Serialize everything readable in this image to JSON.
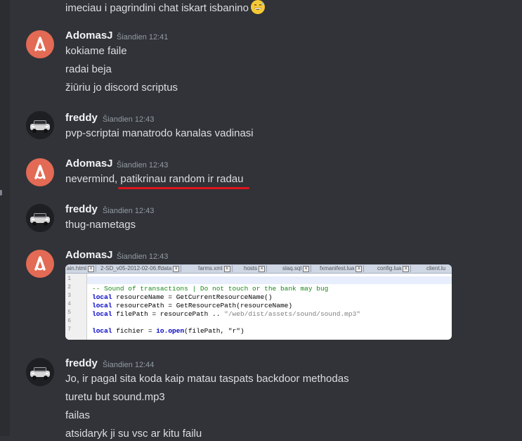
{
  "messages": [
    {
      "lines": [
        "imeciau i pagrindini chat iskart isbanino"
      ],
      "emoji": "grinning-sweat-face"
    },
    {
      "author": "AdomasJ",
      "time": "Šiandien 12:41",
      "avatar": "A",
      "lines": [
        "kokiame faile",
        "radai beja",
        "žiūriu jo discord scriptus"
      ]
    },
    {
      "author": "freddy",
      "time": "Šiandien 12:43",
      "lines": [
        "pvp-scriptai manatrodo kanalas vadinasi"
      ]
    },
    {
      "author": "AdomasJ",
      "time": "Šiandien 12:43",
      "avatar": "A",
      "line_plain": "nevermind, ",
      "line_marked": "patikrinau random ir radau"
    },
    {
      "author": "freddy",
      "time": "Šiandien 12:43",
      "lines": [
        "thug-nametags"
      ]
    },
    {
      "author": "AdomasJ",
      "time": "Šiandien 12:43",
      "avatar": "A"
    },
    {
      "author": "freddy",
      "time": "Šiandien 12:44",
      "lines": [
        "Jo, ir pagal sita koda kaip matau taspats backdoor methodas",
        "turetu but sound.mp3",
        "failas",
        "atsidaryk ji su vsc ar kitu failu"
      ]
    }
  ],
  "attachment": {
    "tabs": [
      "ain.html",
      "2-SD_v05-2012-02-06.ffdata",
      "farms.xml",
      "hosts",
      "slaq.sql",
      "fxmanifest.lua",
      "config.lua",
      "client.lu"
    ],
    "line_numbers": [
      "1",
      "2",
      "3",
      "4",
      "5",
      "6",
      "7"
    ],
    "code": {
      "comment": "-- Sound of transactions | Do not touch or the bank may bug",
      "kw": "local",
      "l3": " resourceName = GetCurrentResourceName()",
      "l4": " resourcePath = GetResourcePath(resourceName)",
      "l5a": " filePath = resourcePath .. ",
      "l5b": "\"/web/dist/assets/sound/sound.mp3\"",
      "l7a": " fichier = ",
      "l7b": "io.open",
      "l7c": "(filePath, \"r\")"
    }
  },
  "colors": {
    "background": "#313338",
    "avatar_a": "#e36a54",
    "underline": "#e0141b",
    "username": "#f2f3f5",
    "timestamp": "#949ba4"
  }
}
